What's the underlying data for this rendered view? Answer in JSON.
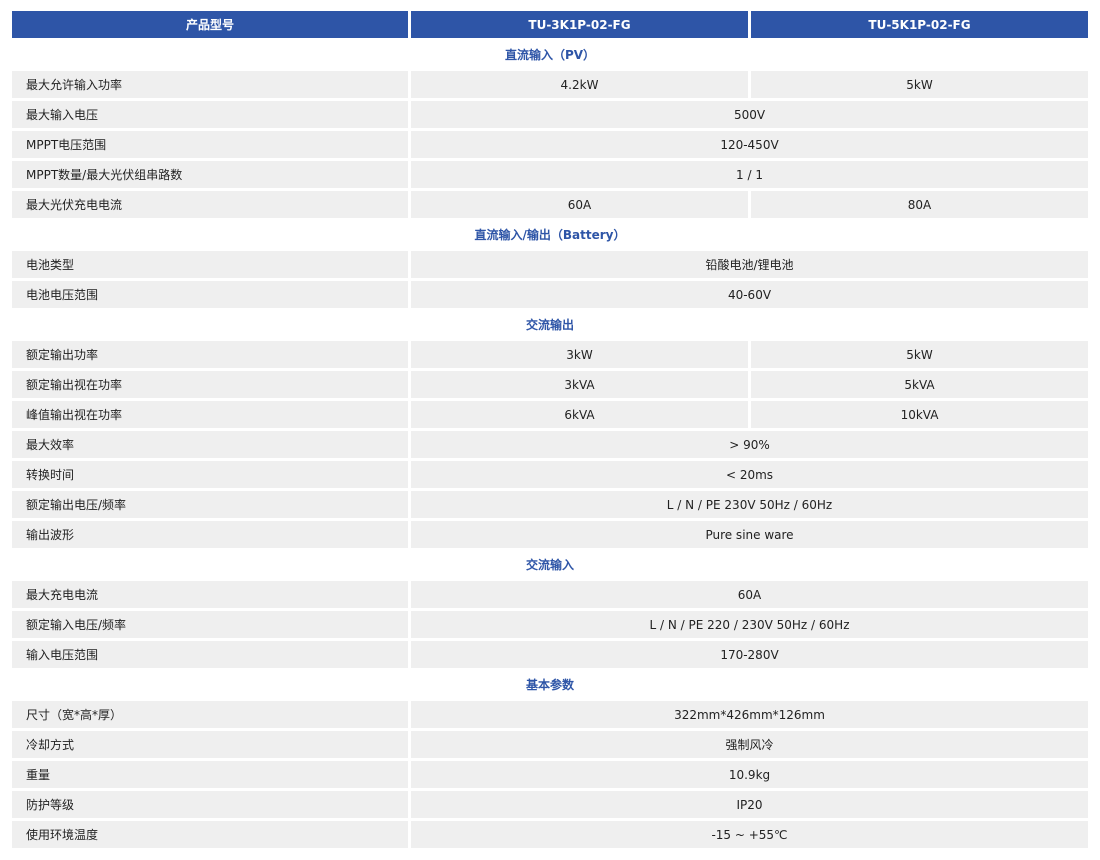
{
  "header": {
    "label": "产品型号",
    "models": [
      "TU-3K1P-02-FG",
      "TU-5K1P-02-FG"
    ]
  },
  "colors": {
    "header_bg": "#2e55a7",
    "header_text": "#ffffff",
    "section_text": "#2e55a7",
    "row_bg": "#efefef"
  },
  "sections": [
    {
      "title": "直流输入（PV）",
      "rows": [
        {
          "label": "最大允许输入功率",
          "values": [
            "4.2kW",
            "5kW"
          ]
        },
        {
          "label": "最大输入电压",
          "values": [
            "500V"
          ]
        },
        {
          "label": "MPPT电压范围",
          "values": [
            "120-450V"
          ]
        },
        {
          "label": "MPPT数量/最大光伏组串路数",
          "values": [
            "1 / 1"
          ]
        },
        {
          "label": "最大光伏充电电流",
          "values": [
            "60A",
            "80A"
          ]
        }
      ]
    },
    {
      "title": "直流输入/输出（Battery）",
      "rows": [
        {
          "label": "电池类型",
          "values": [
            "铅酸电池/锂电池"
          ]
        },
        {
          "label": "电池电压范围",
          "values": [
            "40-60V"
          ]
        }
      ]
    },
    {
      "title": "交流输出",
      "rows": [
        {
          "label": "额定输出功率",
          "values": [
            "3kW",
            "5kW"
          ]
        },
        {
          "label": "额定输出视在功率",
          "values": [
            "3kVA",
            "5kVA"
          ]
        },
        {
          "label": "峰值输出视在功率",
          "values": [
            "6kVA",
            "10kVA"
          ]
        },
        {
          "label": "最大效率",
          "values": [
            "> 90%"
          ]
        },
        {
          "label": "转换时间",
          "values": [
            "< 20ms"
          ]
        },
        {
          "label": "额定输出电压/频率",
          "values": [
            "L / N / PE 230V 50Hz / 60Hz"
          ]
        },
        {
          "label": "输出波形",
          "values": [
            "Pure sine ware"
          ]
        }
      ]
    },
    {
      "title": "交流输入",
      "rows": [
        {
          "label": "最大充电电流",
          "values": [
            "60A"
          ]
        },
        {
          "label": "额定输入电压/频率",
          "values": [
            "L / N / PE 220 / 230V 50Hz / 60Hz"
          ]
        },
        {
          "label": "输入电压范围",
          "values": [
            "170-280V"
          ]
        }
      ]
    },
    {
      "title": "基本参数",
      "rows": [
        {
          "label": "尺寸（宽*高*厚）",
          "values": [
            "322mm*426mm*126mm"
          ]
        },
        {
          "label": "冷却方式",
          "values": [
            "强制风冷"
          ]
        },
        {
          "label": "重量",
          "values": [
            "10.9kg"
          ]
        },
        {
          "label": "防护等级",
          "values": [
            "IP20"
          ]
        },
        {
          "label": "使用环境温度",
          "values": [
            "-15 ~ +55℃"
          ]
        }
      ]
    }
  ]
}
